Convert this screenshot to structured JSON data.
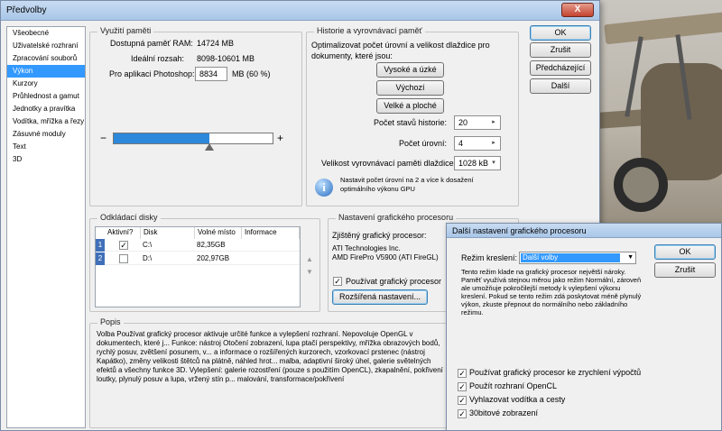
{
  "window": {
    "title": "Předvolby",
    "close_label": "X"
  },
  "sidebar": {
    "items": [
      {
        "label": "Všeobecné"
      },
      {
        "label": "Uživatelské rozhraní"
      },
      {
        "label": "Zpracování souborů"
      },
      {
        "label": "Výkon"
      },
      {
        "label": "Kurzory"
      },
      {
        "label": "Průhlednost a gamut"
      },
      {
        "label": "Jednotky a pravítka"
      },
      {
        "label": "Vodítka, mřížka a řezy"
      },
      {
        "label": "Zásuvné moduly"
      },
      {
        "label": "Text"
      },
      {
        "label": "3D"
      }
    ],
    "active_index": 3
  },
  "memory": {
    "title": "Využití paměti",
    "available_label": "Dostupná paměť RAM:",
    "available_value": "14724 MB",
    "ideal_label": "Ideální rozsah:",
    "ideal_value": "8098-10601 MB",
    "ps_label": "Pro aplikaci Photoshop:",
    "ps_value": "8834",
    "ps_unit": "MB (60 %)",
    "slider_minus": "−",
    "slider_plus": "+",
    "slider_fraction": 0.6
  },
  "history": {
    "title": "Historie a vyrovnávací paměť",
    "desc": "Optimalizovat počet úrovní a velikost dlaždice pro dokumenty, které jsou:",
    "btn_tall": "Vysoké a úzké",
    "btn_default": "Výchozí",
    "btn_flat": "Velké a ploché",
    "states_label": "Počet stavů historie:",
    "states_value": "20",
    "levels_label": "Počet úrovní:",
    "levels_value": "4",
    "tile_label": "Velikost vyrovnávací paměti dlaždice:",
    "tile_value": "1028 kB",
    "note": "Nastavit počet úrovní na 2 a více k dosažení optimálního výkonu GPU"
  },
  "buttons": {
    "ok": "OK",
    "cancel": "Zrušit",
    "prev": "Předcházející",
    "next": "Další"
  },
  "scratch": {
    "title": "Odkládací disky",
    "headers": [
      "Aktivní?",
      "Disk",
      "Volné místo",
      "Informace"
    ],
    "rows": [
      {
        "num": "1",
        "active": "✓",
        "disk": "C:\\",
        "free": "82,35GB"
      },
      {
        "num": "2",
        "active": "",
        "disk": "D:\\",
        "free": "202,97GB"
      }
    ]
  },
  "gpu": {
    "title": "Nastavení grafického procesoru",
    "detected_label": "Zjištěný grafický procesor:",
    "vendor": "ATI Technologies Inc.",
    "model": "AMD FirePro V5900 (ATI FireGL)",
    "use_label": "Používat grafický procesor",
    "use_check": "✓",
    "advanced_button": "Rozšířená nastavení..."
  },
  "description": {
    "title": "Popis",
    "text": "Volba Používat grafický procesor aktivuje určité funkce a vylepšení rozhraní. Nepovoluje OpenGL v dokumentech, které j... Funkce: nástroj Otočení zobrazení, lupa ptačí perspektivy, mřížka obrazových bodů, rychlý posuv, zvětšení posunem, v... a informace o rozšířených kurzorech, vzorkovací prstenec (nástroj Kapátko), změny velikosti štětců na plátně, náhled hrot... malba, adaptivní široký úhel, galerie světelných efektů a všechny funkce 3D. Vylepšení: galerie rozostření (pouze s použitím OpenCL), zkapalnění, pokřivení loutky, plynulý posuv a lupa, vržený stín p... malování, transformace/pokřivení"
  },
  "dialog": {
    "title": "Další nastavení grafického procesoru",
    "mode_label": "Režim kreslení:",
    "mode_value": "Další volby",
    "ok": "OK",
    "cancel": "Zrušit",
    "text": "Tento režim klade na grafický procesor největší nároky. Paměť využívá stejnou měrou jako režim Normální, zároveň ale umožňuje pokročilejší metody k vylepšení výkonu kreslení. Pokud se tento režim zdá poskytovat méně plynulý výkon, zkuste přepnout do normálního nebo základního režimu.",
    "checks": [
      {
        "label": "Používat grafický procesor ke zrychlení výpočtů",
        "check": "✓"
      },
      {
        "label": "Použít rozhraní OpenCL",
        "check": "✓"
      },
      {
        "label": "Vyhlazovat vodítka a cesty",
        "check": "✓"
      },
      {
        "label": "30bitové zobrazení",
        "check": "✓"
      }
    ]
  },
  "colors": {
    "accent": "#3399ff",
    "slider_fill": "#2c88db"
  }
}
